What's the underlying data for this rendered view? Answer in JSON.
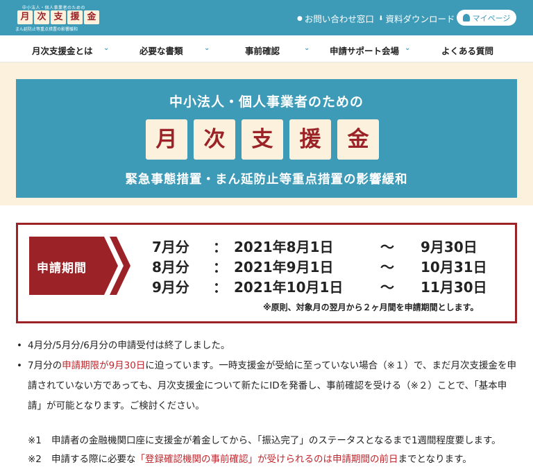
{
  "header": {
    "logo_sub": "中小法人・個人事業者のための",
    "logo_chars": [
      "月",
      "次",
      "支",
      "援",
      "金"
    ],
    "logo_tag": "まん延防止等重点措置の影響緩和",
    "contact_label": "お問い合わせ窓口",
    "download_label": "資料ダウンロード",
    "mypage_label": "マイページ"
  },
  "nav": {
    "items": [
      {
        "label": "月次支援金とは"
      },
      {
        "label": "必要な書類"
      },
      {
        "label": "事前確認"
      },
      {
        "label": "申請サポート会場"
      },
      {
        "label": "よくある質問"
      }
    ]
  },
  "hero": {
    "top": "中小法人・個人事業者のための",
    "chars": [
      "月",
      "次",
      "支",
      "援",
      "金"
    ],
    "sub": "緊急事態措置・まん延防止等重点措置の影響緩和"
  },
  "period": {
    "label": "申請期間",
    "rows": [
      {
        "month": "7月分",
        "sep": "：",
        "start": "2021年8月1日",
        "tilde": "～",
        "end": "9月30日"
      },
      {
        "month": "8月分",
        "sep": "：",
        "start": "2021年9月1日",
        "tilde": "～",
        "end": "10月31日"
      },
      {
        "month": "9月分",
        "sep": "：",
        "start": "2021年10月1日",
        "tilde": "～",
        "end": "11月30日"
      }
    ],
    "note": "※原則、対象月の翌月から２ヶ月間を申請期間とします。"
  },
  "content": {
    "bullet1": "4月分/5月分/6月分の申請受付は終了しました。",
    "bullet2_pre": "7月分の",
    "bullet2_red": "申請期限が9月30日",
    "bullet2_post": "に迫っています。一時支援金が受給に至っていない場合（※１）で、まだ月次支援金を申請されていない方であっても、月次支援金について新たにIDを発番し、事前確認を受ける（※２）ことで、「基本申請」が可能となります。ご検討ください。",
    "note1_label": "※1",
    "note1_text": "申請者の金融機関口座に支援金が着金してから、「振込完了」のステータスとなるまで1週間程度要します。",
    "note2_label": "※2",
    "note2_pre": "申請する際に必要な",
    "note2_red": "「登録確認機関の事前確認」が受けられるのは申請期間の前日",
    "note2_post": "までとなります。"
  },
  "colors": {
    "teal": "#3d9bb8",
    "cream": "#fbf1dc",
    "dark_red": "#9b2226",
    "red_text": "#c0262d"
  }
}
